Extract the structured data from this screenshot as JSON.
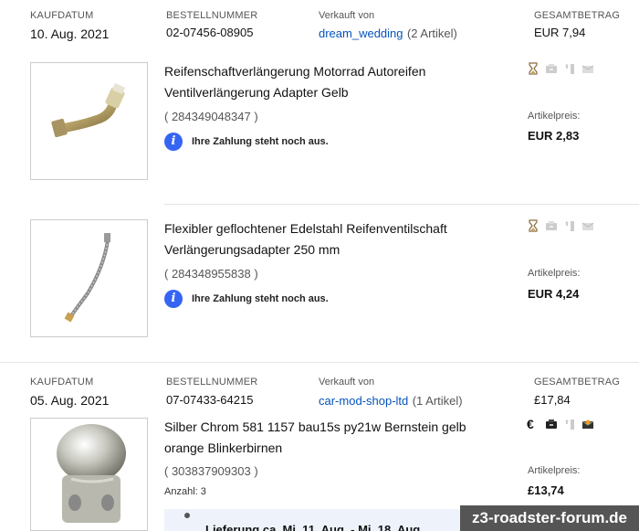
{
  "orders": [
    {
      "date_label": "KAUFDATUM",
      "date": "10. Aug. 2021",
      "order_no_label": "BESTELLNUMMER",
      "order_no": "02-07456-08905",
      "seller_label": "Verkauft von",
      "seller": "dream_wedding",
      "seller_count": "(2 Artikel)",
      "total_label": "GESAMTBETRAG",
      "total": "EUR 7,94",
      "items": [
        {
          "title_line1": "Reifenschaftverlängerung Motorrad Autoreifen",
          "title_line2": "Ventilverlängerung Adapter Gelb",
          "item_number": "( 284349048347 )",
          "note": "Ihre Zahlung steht noch aus.",
          "price_label": "Artikelpreis:",
          "price": "EUR 2,83",
          "icons": [
            "hourglass-icon",
            "paid-icon",
            "shipped-icon",
            "feedback-icon"
          ]
        },
        {
          "title_line1": "Flexibler geflochtener Edelstahl Reifenventilschaft",
          "title_line2": "Verlängerungsadapter 250 mm",
          "item_number": "( 284348955838 )",
          "note": "Ihre Zahlung steht noch aus.",
          "price_label": "Artikelpreis:",
          "price": "EUR 4,24",
          "icons": [
            "hourglass-icon",
            "paid-icon",
            "shipped-icon",
            "feedback-icon"
          ]
        }
      ]
    },
    {
      "date_label": "KAUFDATUM",
      "date": "05. Aug. 2021",
      "order_no_label": "BESTELLNUMMER",
      "order_no": "07-07433-64215",
      "seller_label": "Verkauft von",
      "seller": "car-mod-shop-ltd",
      "seller_count": "(1 Artikel)",
      "total_label": "GESAMTBETRAG",
      "total": "£17,84",
      "items": [
        {
          "title_line1": "Silber Chrom 581 1157 bau15s py21w Bernstein gelb",
          "title_line2": "orange Blinkerbirnen",
          "item_number": "( 303837909303 )",
          "quantity": "Anzahl: 3",
          "price_label": "Artikelpreis:",
          "price": "£13,74",
          "icons": [
            "euro-icon",
            "paid-icon",
            "shipped-icon",
            "feedback-icon"
          ],
          "delivery": "Lieferung ca. Mi. 11. Aug. - Mi. 18. Aug."
        }
      ]
    }
  ],
  "watermark": "z3-roadster-forum.de"
}
